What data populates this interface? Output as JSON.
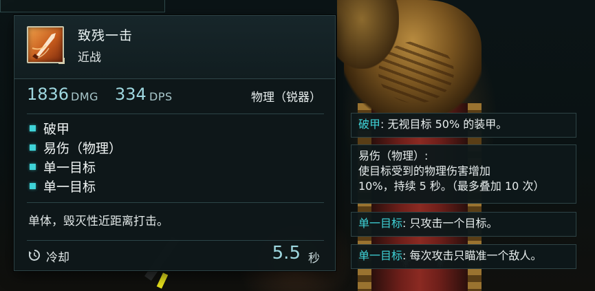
{
  "skill": {
    "name": "致残一击",
    "category": "近战",
    "icon": "sword-strike-icon",
    "damage_value": "1836",
    "damage_unit": "DMG",
    "dps_value": "334",
    "dps_unit": "DPS",
    "damage_type": "物理（锐器）",
    "keywords": [
      {
        "label": "破甲"
      },
      {
        "label": "易伤（物理）"
      },
      {
        "label": "单一目标"
      },
      {
        "label": "单一目标"
      }
    ],
    "description": "单体，毁灭性近距离打击。",
    "cooldown_label": "冷却",
    "cooldown_value": "5.5",
    "cooldown_unit": "秒"
  },
  "keyword_details": [
    {
      "name": "破甲",
      "text": ": 无视目标 50% 的装甲。"
    },
    {
      "name": "易伤（物理）",
      "text": ":",
      "extra_lines": [
        "使目标受到的物理伤害增加",
        "10%，持续 5 秒。（最多叠加 10 次）"
      ]
    },
    {
      "name": "单一目标",
      "text": ": 只攻击一个目标。"
    },
    {
      "name": "单一目标",
      "text": ": 每次攻击只瞄准一个敌人。"
    }
  ],
  "colors": {
    "accent": "#3fd3d8",
    "stat_value": "#9fd8e0",
    "panel_bg": "#0e181a",
    "panel_border": "#2e4446"
  }
}
